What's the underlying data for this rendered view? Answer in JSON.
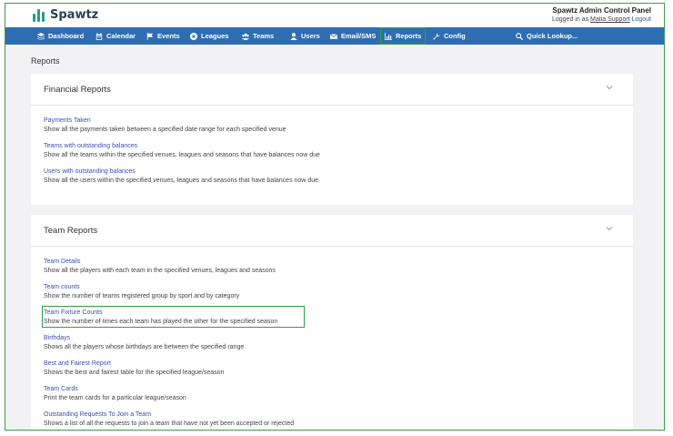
{
  "app": {
    "name": "Spawtz",
    "admin_title": "Spawtz Admin Control Panel",
    "logged_in_prefix": "Logged in as",
    "user": "Matia Support",
    "logout": "Logout"
  },
  "nav": [
    {
      "label": "Dashboard",
      "icon": "layers-icon"
    },
    {
      "label": "Calendar",
      "icon": "calendar-icon"
    },
    {
      "label": "Events",
      "icon": "flag-icon"
    },
    {
      "label": "Leagues",
      "icon": "ball-icon"
    },
    {
      "label": "Teams",
      "icon": "users-icon"
    },
    {
      "label": "Users",
      "icon": "user-icon"
    },
    {
      "label": "Email/SMS",
      "icon": "envelope-icon"
    },
    {
      "label": "Reports",
      "icon": "chart-icon",
      "active": true
    },
    {
      "label": "Config",
      "icon": "wrench-icon"
    },
    {
      "label": "Quick Lookup...",
      "icon": "search-icon"
    }
  ],
  "page": {
    "title": "Reports"
  },
  "sections": [
    {
      "title": "Financial Reports",
      "reports": [
        {
          "name": "Payments Taken",
          "desc": "Show all the payments taken between a specified date range for each specified venue"
        },
        {
          "name": "Teams with outstanding balances",
          "desc": "Show all the teams within the specified venues, leagues and seasons that have balances now due"
        },
        {
          "name": "Users with outstanding balances",
          "desc": "Show all the users within the specified venues, leagues and seasons that have balances now due"
        }
      ]
    },
    {
      "title": "Team Reports",
      "reports": [
        {
          "name": "Team Details",
          "desc": "Show all the players with each team in the specified venues, leagues and seasons"
        },
        {
          "name": "Team counts",
          "desc": "Show the number of teams registered group by sport and by category"
        },
        {
          "name": "Team Fixture Counts",
          "desc": "Show the number of times each team has played the other for the specified season",
          "highlighted": true
        },
        {
          "name": "Birthdays",
          "desc": "Shows all the players whose birthdays are between the specified range"
        },
        {
          "name": "Best and Fairest Report",
          "desc": "Shows the best and fairest table for the specified league/season"
        },
        {
          "name": "Team Cards",
          "desc": "Print the team cards for a particular league/season"
        },
        {
          "name": "Outstanding Requests To Join a Team",
          "desc": "Shows a list of all the requests to join a team that have not yet been accepted or rejected"
        }
      ]
    }
  ],
  "colors": {
    "nav_bg": "#2f6db3",
    "link": "#3a4fb0",
    "highlight": "#2ea043",
    "logo": "#26a17a",
    "content_bg": "#f2f2f4"
  }
}
